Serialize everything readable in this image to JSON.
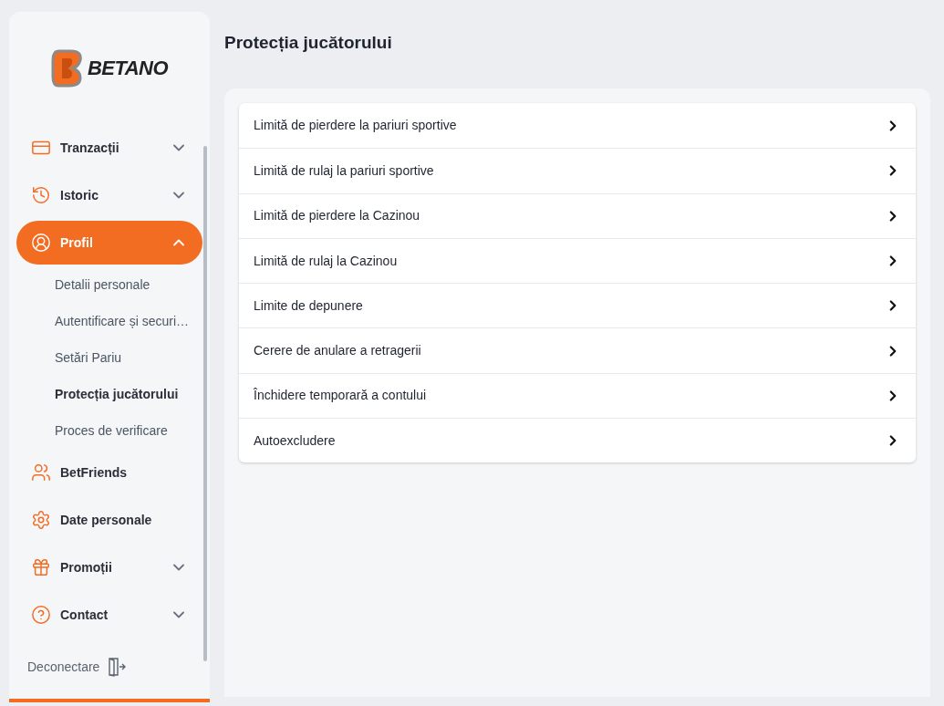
{
  "logo": {
    "text": "BETANO"
  },
  "sidebar": {
    "items": [
      {
        "label": "Tranzacții",
        "kind": "group",
        "expanded": false,
        "selected": false
      },
      {
        "label": "Istoric",
        "kind": "group",
        "expanded": false,
        "selected": false
      },
      {
        "label": "Profil",
        "kind": "group",
        "expanded": true,
        "selected": true,
        "children": [
          {
            "label": "Detalii personale",
            "selected": false
          },
          {
            "label": "Autentificare și securi…",
            "selected": false
          },
          {
            "label": "Setări Pariu",
            "selected": false
          },
          {
            "label": "Protecția jucătorului",
            "selected": true
          },
          {
            "label": "Proces de verificare",
            "selected": false
          }
        ]
      },
      {
        "label": "BetFriends",
        "kind": "link",
        "selected": false
      },
      {
        "label": "Date personale",
        "kind": "link",
        "selected": false
      },
      {
        "label": "Promoții",
        "kind": "group",
        "expanded": false,
        "selected": false
      },
      {
        "label": "Contact",
        "kind": "group",
        "expanded": false,
        "selected": false
      }
    ],
    "logout": "Deconectare"
  },
  "page": {
    "title": "Protecția jucătorului"
  },
  "options": [
    {
      "label": "Limită de pierdere la pariuri sportive"
    },
    {
      "label": "Limită de rulaj la pariuri sportive"
    },
    {
      "label": "Limită de pierdere la Cazinou"
    },
    {
      "label": "Limită de rulaj la Cazinou"
    },
    {
      "label": "Limite de depunere"
    },
    {
      "label": "Cerere de anulare a retragerii"
    },
    {
      "label": "Închidere temporară a contului"
    },
    {
      "label": "Autoexcludere"
    }
  ]
}
